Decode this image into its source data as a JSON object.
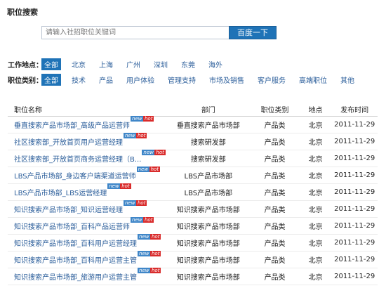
{
  "page": {
    "title": "职位搜索"
  },
  "search": {
    "placeholder": "请输入社招职位关键词",
    "button_label": "百度一下"
  },
  "filters": {
    "location": {
      "label": "工作地点：",
      "options": [
        "全部",
        "北京",
        "上海",
        "广州",
        "深圳",
        "东莞",
        "海外"
      ],
      "selected": "全部"
    },
    "category": {
      "label": "职位类别：",
      "options": [
        "全部",
        "技术",
        "产品",
        "用户体验",
        "管理支持",
        "市场及销售",
        "客户服务",
        "高端职位",
        "其他"
      ],
      "selected": "全部"
    }
  },
  "table": {
    "headers": {
      "name": "职位名称",
      "dept": "部门",
      "category": "职位类别",
      "location": "地点",
      "date": "发布时间"
    },
    "badge_new": "new",
    "badge_hot": "hot",
    "rows": [
      {
        "name": "垂直搜索产品市场部_高级产品运营师",
        "dept": "垂直搜索产品市场部",
        "category": "产品类",
        "location": "北京",
        "date": "2011-11-29"
      },
      {
        "name": "社区搜索部_开放首页用户运营经理",
        "dept": "搜索研发部",
        "category": "产品类",
        "location": "北京",
        "date": "2011-11-29"
      },
      {
        "name": "社区搜索部_开放首页商务运营经理（B...",
        "dept": "搜索研发部",
        "category": "产品类",
        "location": "北京",
        "date": "2011-11-29"
      },
      {
        "name": "LBS产品市场部_身边客户端渠道运营师",
        "dept": "LBS产品市场部",
        "category": "产品类",
        "location": "北京",
        "date": "2011-11-29"
      },
      {
        "name": "LBS产品市场部_LBS运营经理",
        "dept": "LBS产品市场部",
        "category": "产品类",
        "location": "北京",
        "date": "2011-11-29"
      },
      {
        "name": "知识搜索产品市场部_知识运营经理",
        "dept": "知识搜索产品市场部",
        "category": "产品类",
        "location": "北京",
        "date": "2011-11-29"
      },
      {
        "name": "知识搜索产品市场部_百科产品运营师",
        "dept": "知识搜索产品市场部",
        "category": "产品类",
        "location": "北京",
        "date": "2011-11-29"
      },
      {
        "name": "知识搜索产品市场部_百科用户运营经理",
        "dept": "知识搜索产品市场部",
        "category": "产品类",
        "location": "北京",
        "date": "2011-11-29"
      },
      {
        "name": "知识搜索产品市场部_百科用户运营主管",
        "dept": "知识搜索产品市场部",
        "category": "产品类",
        "location": "北京",
        "date": "2011-11-29"
      },
      {
        "name": "知识搜索产品市场部_旅游用户运营主管",
        "dept": "知识搜索产品市场部",
        "category": "产品类",
        "location": "北京",
        "date": "2011-11-29"
      }
    ]
  }
}
